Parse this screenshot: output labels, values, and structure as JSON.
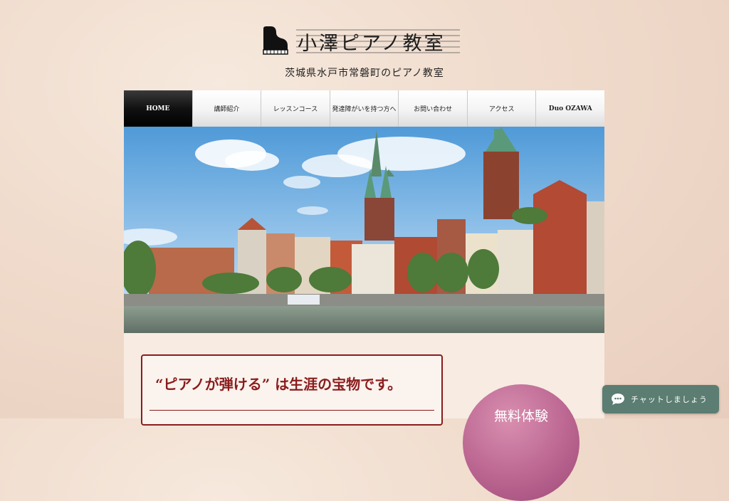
{
  "header": {
    "logo_text": "小澤ピアノ教室",
    "tagline": "茨城県水戸市常磐町のピアノ教室"
  },
  "nav": {
    "items": [
      {
        "label": "HOME",
        "active": true
      },
      {
        "label": "講師紹介"
      },
      {
        "label": "レッスンコース"
      },
      {
        "label": "発達障がいを持つ方へ"
      },
      {
        "label": "お問い合わせ"
      },
      {
        "label": "アクセス"
      },
      {
        "label": "Duo OZAWA"
      }
    ]
  },
  "main": {
    "headline": "“ピアノが弾ける” は生涯の宝物です。",
    "trial_label": "無料体験"
  },
  "chat": {
    "label": "チャットしましょう"
  },
  "colors": {
    "accent": "#8a1c1c",
    "chat_bg": "#5b7d72",
    "trial_circle": "#b8628e",
    "nav_active": "#111111"
  },
  "icons": {
    "logo": "grand-piano-icon",
    "chat": "chat-bubble-icon"
  }
}
